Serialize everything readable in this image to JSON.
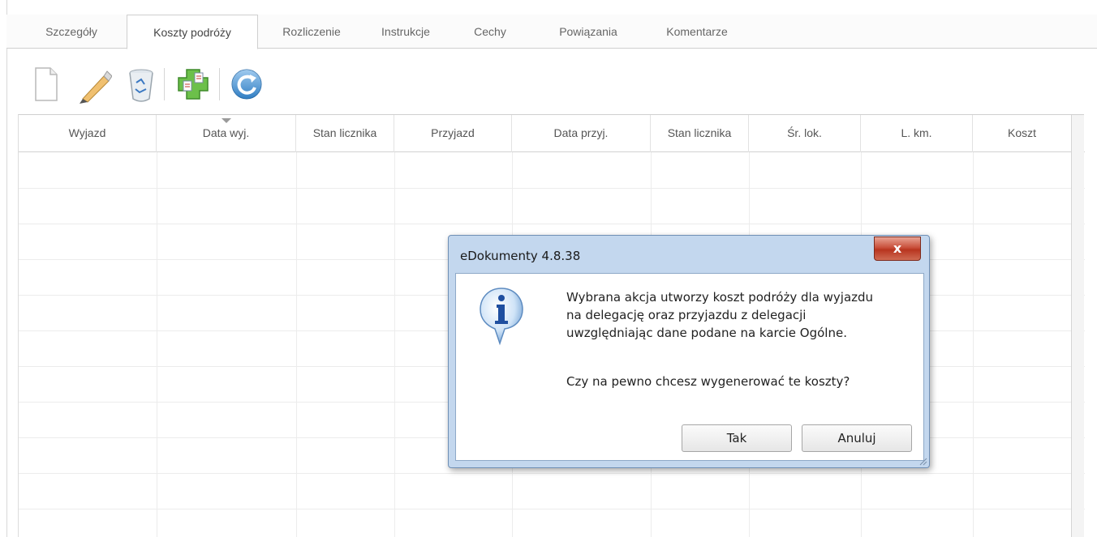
{
  "tabs": [
    {
      "label": "Szczegóły",
      "active": false
    },
    {
      "label": "Koszty podróży",
      "active": true
    },
    {
      "label": "Rozliczenie",
      "active": false
    },
    {
      "label": "Instrukcje",
      "active": false
    },
    {
      "label": "Cechy",
      "active": false
    },
    {
      "label": "Powiązania",
      "active": false
    },
    {
      "label": "Komentarze",
      "active": false
    }
  ],
  "toolbar": {
    "icons": [
      "new-document-icon",
      "edit-pencil-icon",
      "recycle-bin-icon",
      "generate-costs-icon",
      "refresh-icon"
    ]
  },
  "grid": {
    "columns": [
      "Wyjazd",
      "Data wyj.",
      "Stan licznika",
      "Przyjazd",
      "Data przyj.",
      "Stan licznika",
      "Śr. lok.",
      "L. km.",
      "Koszt"
    ],
    "sorted_column": "Data wyj.",
    "rows": []
  },
  "dialog": {
    "title": "eDokumenty 4.8.38",
    "close_label": "x",
    "icon": "info-icon",
    "message_lines": [
      "Wybrana akcja utworzy koszt podróży dla wyjazdu",
      "na delegację oraz przyjazdu z delegacji",
      "uwzględniając dane podane na karcie Ogólne."
    ],
    "question": "Czy na pewno chcesz wygenerować te koszty?",
    "ok_label": "Tak",
    "cancel_label": "Anuluj"
  },
  "colors": {
    "dialog_frame": "#c3d7ee",
    "close_button": "#c9503b",
    "tab_border": "#cfcfcf"
  }
}
